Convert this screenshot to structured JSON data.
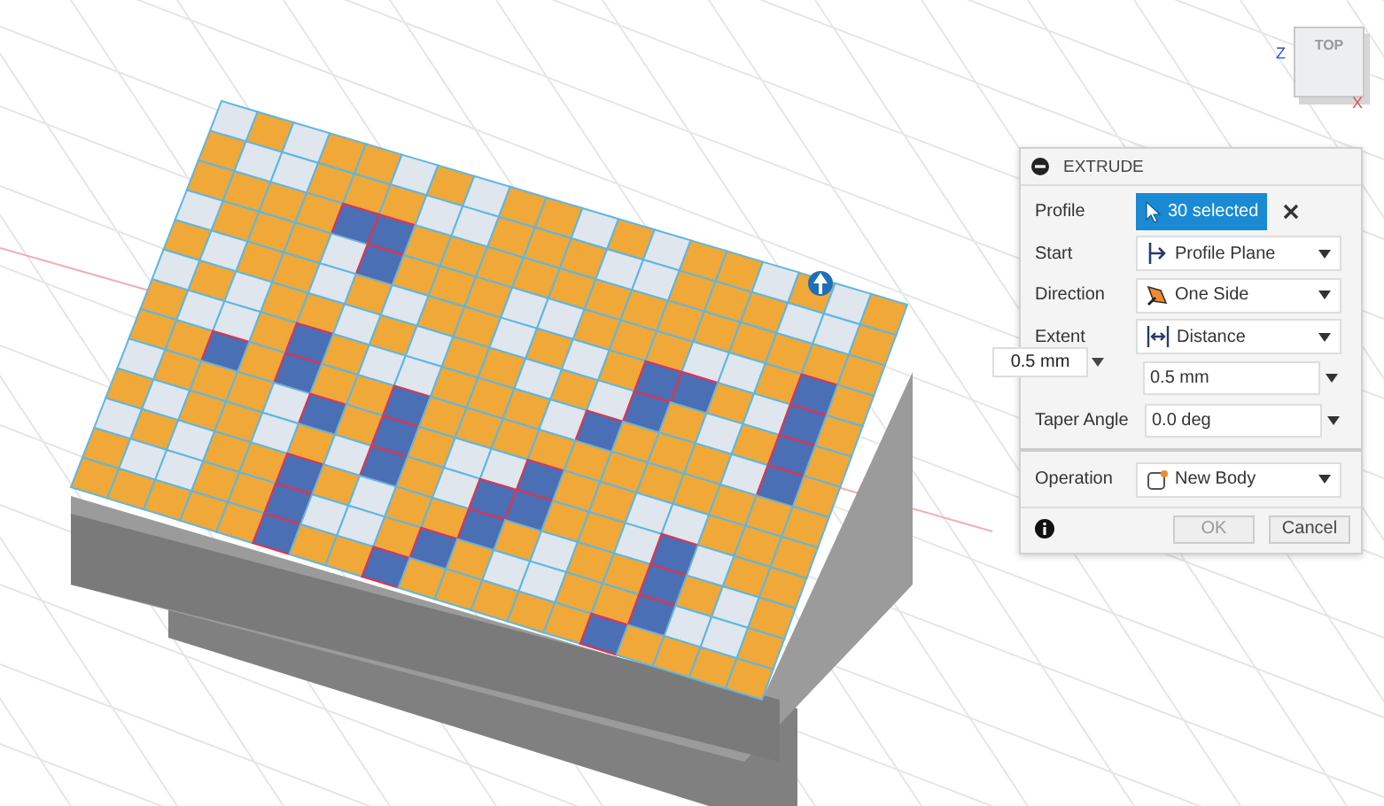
{
  "viewcube": {
    "face_label": "TOP",
    "axis_labels": [
      "Z",
      "X"
    ]
  },
  "distance_manipulator": {
    "value": "0.5 mm"
  },
  "dialog": {
    "title": "EXTRUDE",
    "rows": [
      {
        "kind": "selection",
        "label": "Profile",
        "value": "30 selected"
      },
      {
        "kind": "dropdown",
        "label": "Start",
        "value": "Profile Plane"
      },
      {
        "kind": "dropdown",
        "label": "Direction",
        "value": "One Side"
      },
      {
        "kind": "dropdown",
        "label": "Extent",
        "value": "Distance"
      },
      {
        "kind": "input",
        "label": "",
        "value": "0.5 mm"
      },
      {
        "kind": "input",
        "label": "Taper Angle",
        "value": "0.0 deg"
      },
      {
        "kind": "divider"
      },
      {
        "kind": "dropdown",
        "label": "Operation",
        "value": "New Body"
      }
    ],
    "buttons": [
      {
        "label": "OK",
        "disabled": true
      },
      {
        "label": "Cancel",
        "disabled": false
      }
    ]
  }
}
